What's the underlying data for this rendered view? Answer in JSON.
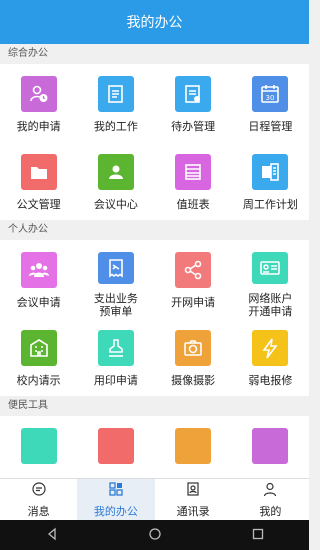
{
  "header": {
    "title": "我的办公"
  },
  "sections": [
    {
      "title": "综合办公",
      "items": [
        {
          "label": "我的申请",
          "icon": "person-clock-icon",
          "color": "#c86bd8"
        },
        {
          "label": "我的工作",
          "icon": "document-icon",
          "color": "#3aa9ee"
        },
        {
          "label": "待办管理",
          "icon": "checklist-icon",
          "color": "#3aa9ee"
        },
        {
          "label": "日程管理",
          "icon": "calendar-icon",
          "color": "#4f8fe8",
          "day": "30"
        },
        {
          "label": "公文管理",
          "icon": "folder-icon",
          "color": "#f26b6b"
        },
        {
          "label": "会议中心",
          "icon": "users-icon",
          "color": "#5cb531"
        },
        {
          "label": "值班表",
          "icon": "table-icon",
          "color": "#d866e0"
        },
        {
          "label": "周工作计划",
          "icon": "plan-icon",
          "color": "#3aa9ee"
        }
      ]
    },
    {
      "title": "个人办公",
      "items": [
        {
          "label": "会议申请",
          "icon": "group-icon",
          "color": "#e472e6"
        },
        {
          "label": "支出业务\n预审单",
          "icon": "receipt-icon",
          "color": "#4f8fe8"
        },
        {
          "label": "开网申请",
          "icon": "share-icon",
          "color": "#f27a7a"
        },
        {
          "label": "网络账户\n开通申请",
          "icon": "id-card-icon",
          "color": "#3dd9b8"
        },
        {
          "label": "校内请示",
          "icon": "building-icon",
          "color": "#5cb531"
        },
        {
          "label": "用印申请",
          "icon": "stamp-icon",
          "color": "#3dd9b8"
        },
        {
          "label": "摄像摄影",
          "icon": "camera-icon",
          "color": "#f0a23a"
        },
        {
          "label": "弱电报修",
          "icon": "lightning-icon",
          "color": "#f5c21a"
        }
      ]
    },
    {
      "title": "便民工具",
      "items": [
        {
          "label": "",
          "icon": "tool-icon",
          "color": "#3dd9b8"
        },
        {
          "label": "",
          "icon": "tool-icon",
          "color": "#f26b6b"
        },
        {
          "label": "",
          "icon": "tool-icon",
          "color": "#f0a23a"
        },
        {
          "label": "",
          "icon": "tool-icon",
          "color": "#c86bd8"
        }
      ]
    }
  ],
  "tabs": [
    {
      "label": "消息",
      "icon": "chat-icon",
      "active": false
    },
    {
      "label": "我的办公",
      "icon": "grid-icon",
      "active": true
    },
    {
      "label": "通讯录",
      "icon": "contacts-icon",
      "active": false
    },
    {
      "label": "我的",
      "icon": "user-icon",
      "active": false
    }
  ],
  "navbar": [
    "back-icon",
    "home-icon",
    "recents-icon"
  ]
}
